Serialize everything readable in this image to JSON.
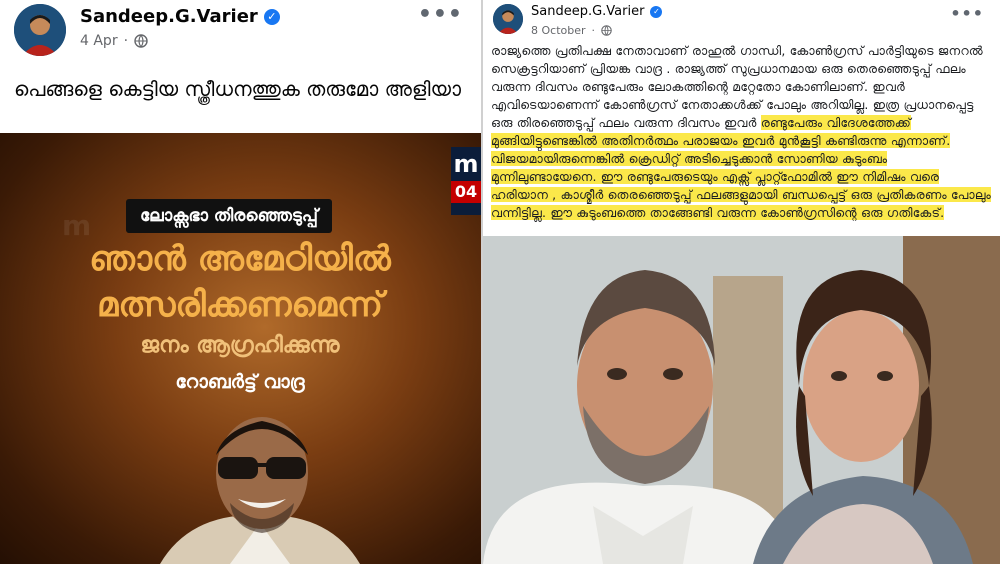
{
  "left_post": {
    "author": "Sandeep.G.Varier",
    "verified_symbol": "✓",
    "timestamp": "4 Apr",
    "privacy_icon": "globe-icon",
    "more_label": "•••",
    "caption": "പെങ്ങളെ കെട്ടിയ സ്ത്രീധനത്തുക തരുമോ അളിയാ",
    "card": {
      "brand": "m",
      "date_badge": "04",
      "tag": "ലോക്സഭാ തിരഞ്ഞെടുപ്പ്",
      "headline_1": "ഞാൻ അമേഠിയിൽ",
      "headline_2": "മത്സരിക്കണമെന്ന്",
      "headline_3": "ജനം ആഗ്രഹിക്കുന്നു",
      "speaker": "റോബർട്ട് വാദ്ര"
    }
  },
  "right_post": {
    "author": "Sandeep.G.Varier",
    "verified_symbol": "✓",
    "timestamp": "8 October",
    "privacy_icon": "globe-icon",
    "more_label": "•••",
    "body_plain": "രാജ്യത്തെ പ്രതിപക്ഷ നേതാവാണ് രാഹുൽ ഗാന്ധി, കോൺഗ്രസ് പാർട്ടിയുടെ ജനറൽ സെക്രട്ടറിയാണ് പ്രിയങ്ക വാദ്ര . രാജ്യത്ത് സുപ്രധാനമായ ഒരു തെരഞ്ഞെടുപ്പ് ഫലം വരുന്ന ദിവസം രണ്ടുപേരും ലോകത്തിന്റെ മറ്റേതോ കോണിലാണ്. ഇവർ എവിടെയാണെന്ന് കോൺഗ്രസ് നേതാക്കൾക്ക് പോലും അറിയില്ല. ഇത്ര പ്രധാനപ്പെട്ട ഒരു തിരഞ്ഞെടുപ്പ് ഫലം വരുന്ന ദിവസം ഇവർ",
    "body_highlight": "രണ്ടുപേരും വിദേശത്തേക്ക് മുങ്ങിയിട്ടുണ്ടെങ്കിൽ അതിനർത്ഥം പരാജയം ഇവർ മുൻകൂട്ടി കണ്ടിരുന്നു എന്നാണ്. വിജയമായിരുന്നെങ്കിൽ ക്രെഡിറ്റ് അടിച്ചെടുക്കാൻ സോണിയ കുടുംബം മുന്നിലുണ്ടായേനെ. ഈ രണ്ടുപേരുടെയും എക്സ് പ്ലാറ്റ്ഫോമിൽ ഈ നിമിഷം വരെ ഹരിയാന , കാശ്മീർ തെരഞ്ഞെടുപ്പ് ഫലങ്ങളുമായി ബന്ധപ്പെട്ട് ഒരു പ്രതികരണം പോലും വന്നിട്ടില്ല. ഈ കുടുംബത്തെ താങ്ങേണ്ടി വരുന്ന കോൺഗ്രസിന്റെ ഒരു ഗതികേട്."
  }
}
